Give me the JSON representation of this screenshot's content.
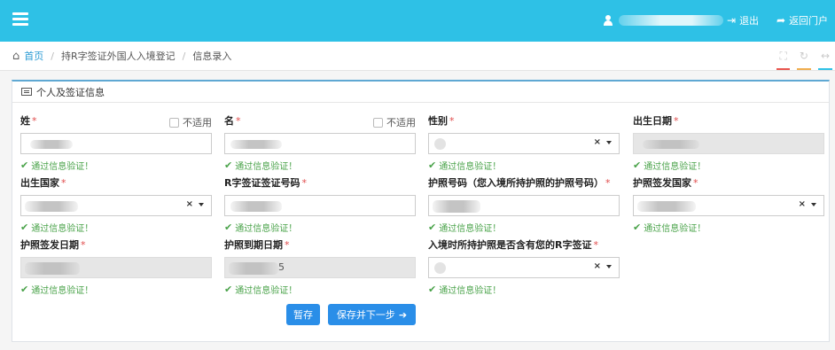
{
  "topbar": {
    "menu_icon": "hamburger-icon",
    "user_icon": "user-icon",
    "logout_label": "退出",
    "logout_icon": "sign-out-icon",
    "portal_label": "返回门户",
    "portal_icon": "share-arrow-icon"
  },
  "breadcrumb": {
    "home_icon": "home-icon",
    "home": "首页",
    "item1": "持R字签证外国人入境登记",
    "item2": "信息录入",
    "separator": "/",
    "tool_icons": [
      "fullscreen-icon",
      "refresh-icon",
      "collapse-icon"
    ],
    "tool_colors": [
      "#e8554e",
      "#f0ad4e",
      "#2ec1e6"
    ]
  },
  "panel": {
    "title": "个人及签证信息",
    "title_icon": "id-card-icon"
  },
  "form": {
    "surname_label": "姓",
    "given_name_label": "名",
    "not_applicable": "不适用",
    "gender_label": "性别",
    "birth_date_label": "出生日期",
    "birth_country_label": "出生国家",
    "visa_no_label": "R字签证签证号码",
    "passport_no_label": "护照号码（您入境所持护照的护照号码）",
    "passport_country_label": "护照签发国家",
    "passport_issue_label": "护照签发日期",
    "passport_expiry_label": "护照到期日期",
    "passport_expiry_value_tail": "5",
    "contains_visa_label": "入境时所持护照是否含有您的R字签证",
    "required_mark": "*",
    "clear_mark": "×",
    "validation_ok": "通过信息验证！"
  },
  "buttons": {
    "save": "暂存",
    "save_next": "保存并下一步",
    "next_arrow": "➔"
  },
  "colors": {
    "topbar": "#2ec1e6",
    "button": "#2a8ee8",
    "valid": "#4aa34a",
    "required": "#e04b4b"
  }
}
